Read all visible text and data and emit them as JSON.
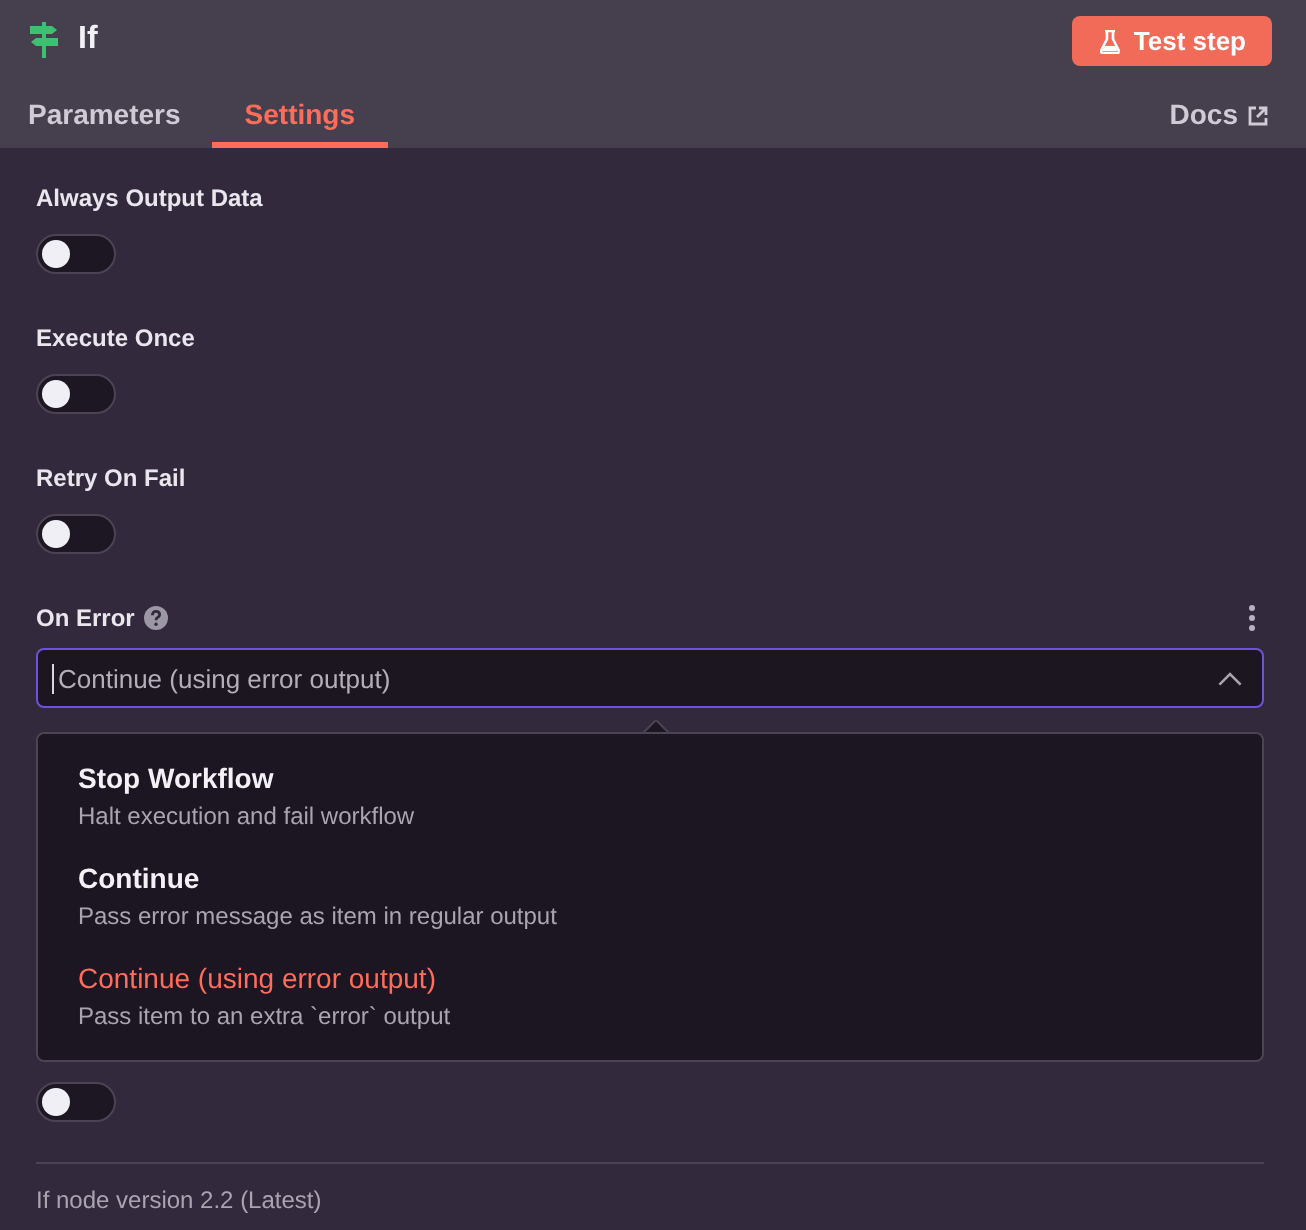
{
  "header": {
    "title": "If",
    "test_button": "Test step"
  },
  "tabs": [
    {
      "label": "Parameters",
      "selected": false
    },
    {
      "label": "Settings",
      "selected": true
    }
  ],
  "docs_link": "Docs",
  "settings": [
    {
      "label": "Always Output Data",
      "on": false
    },
    {
      "label": "Execute Once",
      "on": false
    },
    {
      "label": "Retry On Fail",
      "on": false
    }
  ],
  "on_error": {
    "label": "On Error",
    "value": "Continue (using error output)",
    "expanded": true,
    "options": [
      {
        "title": "Stop Workflow",
        "description": "Halt execution and fail workflow",
        "selected": false
      },
      {
        "title": "Continue",
        "description": "Pass error message as item in regular output",
        "selected": false
      },
      {
        "title": "Continue (using error output)",
        "description": "Pass item to an extra `error` output",
        "selected": true
      }
    ]
  },
  "extra_toggle": {
    "on": false
  },
  "footer": "If node version 2.2 (Latest)"
}
